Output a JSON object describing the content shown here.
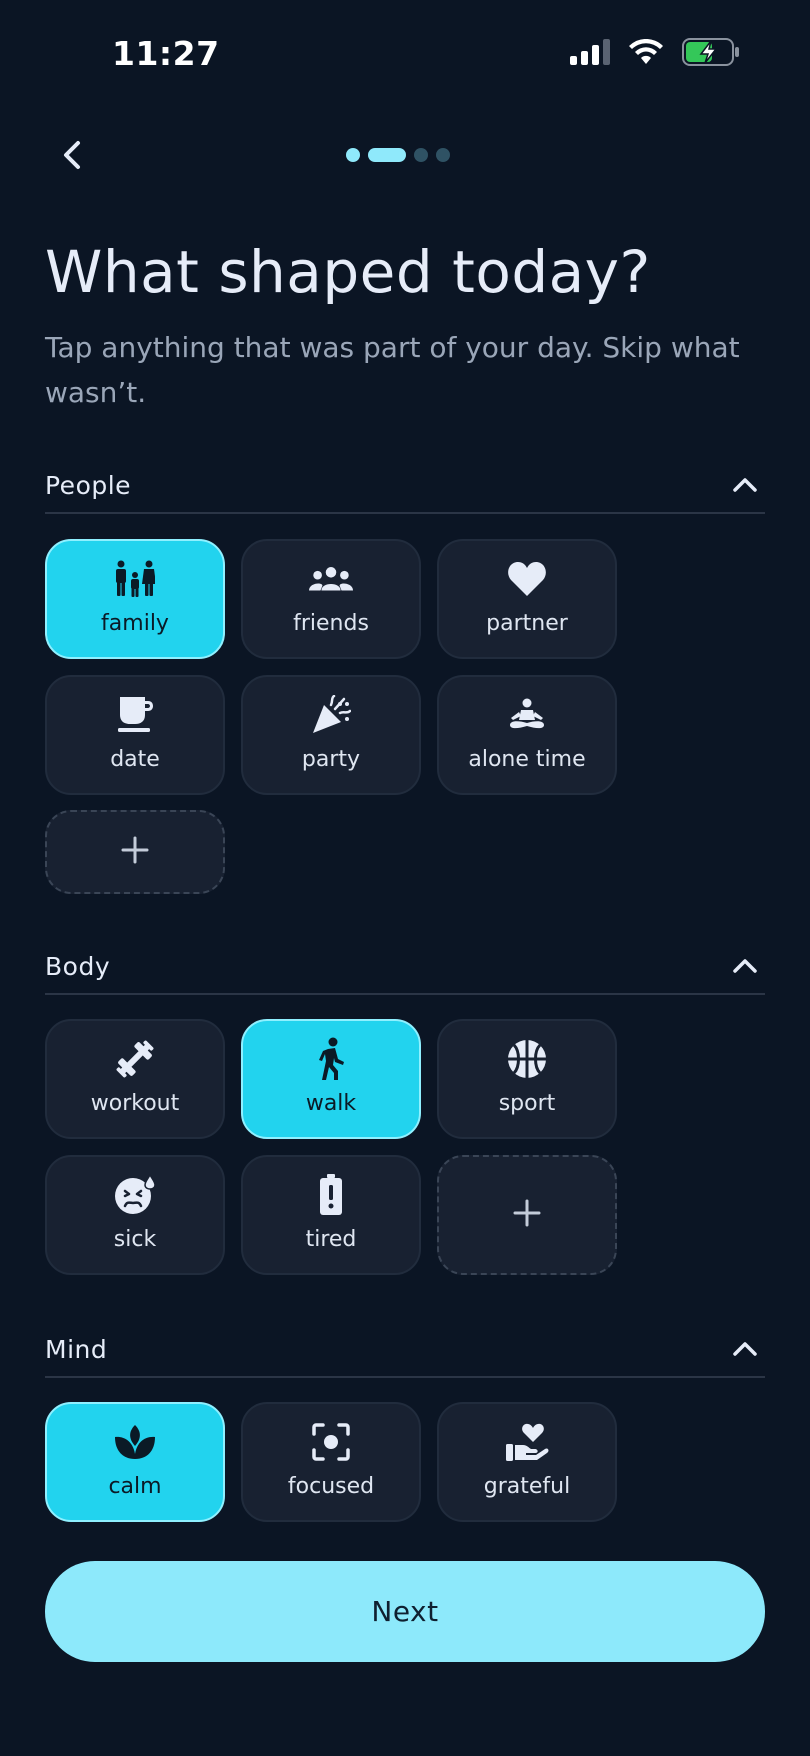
{
  "status_bar": {
    "time": "11:27"
  },
  "header": {
    "title": "What shaped today?",
    "subtitle": "Tap anything that was part of your day. Skip what wasn’t.",
    "progress": {
      "total": 4,
      "current": 2
    }
  },
  "sections": {
    "people": {
      "title": "People",
      "chips": [
        {
          "label": "family",
          "icon": "family-icon",
          "selected": true
        },
        {
          "label": "friends",
          "icon": "group-icon",
          "selected": false
        },
        {
          "label": "partner",
          "icon": "heart-icon",
          "selected": false
        },
        {
          "label": "date",
          "icon": "coffee-icon",
          "selected": false
        },
        {
          "label": "party",
          "icon": "party-popper-icon",
          "selected": false
        },
        {
          "label": "alone time",
          "icon": "meditation-icon",
          "selected": false
        }
      ]
    },
    "body": {
      "title": "Body",
      "chips": [
        {
          "label": "workout",
          "icon": "dumbbell-icon",
          "selected": false
        },
        {
          "label": "walk",
          "icon": "walking-icon",
          "selected": true
        },
        {
          "label": "sport",
          "icon": "basketball-icon",
          "selected": false
        },
        {
          "label": "sick",
          "icon": "sick-face-icon",
          "selected": false
        },
        {
          "label": "tired",
          "icon": "low-battery-icon",
          "selected": false
        }
      ]
    },
    "mind": {
      "title": "Mind",
      "chips": [
        {
          "label": "calm",
          "icon": "lotus-icon",
          "selected": true
        },
        {
          "label": "focused",
          "icon": "focus-target-icon",
          "selected": false
        },
        {
          "label": "grateful",
          "icon": "hand-heart-icon",
          "selected": false
        }
      ]
    }
  },
  "actions": {
    "next_label": "Next",
    "add_symbol": "+"
  },
  "colors": {
    "background": "#0b1524",
    "accent": "#22d3ee",
    "button": "#8de9fb",
    "chip": "#182131"
  }
}
